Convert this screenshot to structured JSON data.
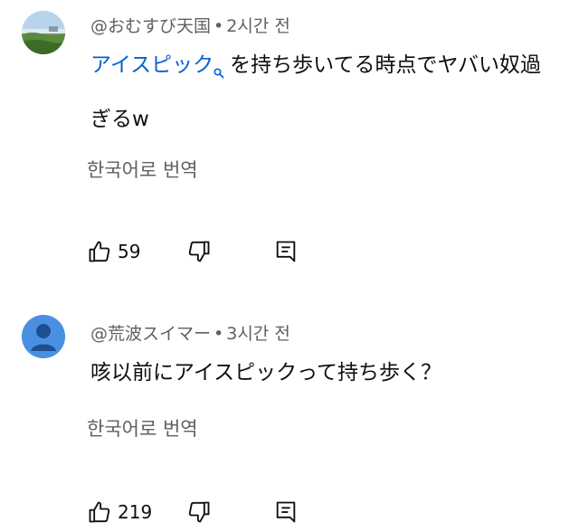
{
  "comments": [
    {
      "author": "@おむすび天国",
      "separator": "•",
      "time": "2시간 전",
      "link_text": "アイスピック",
      "text_after_link": "を持ち歩いてる時点でヤバい奴過ぎるw",
      "translate_label": "한국어로 번역",
      "likes": "59",
      "avatar_icon": "landscape-avatar"
    },
    {
      "author": "@荒波スイマー",
      "separator": "•",
      "time": "3시간 전",
      "text": "咳以前にアイスピックって持ち歩く？",
      "translate_label": "한국어로 번역",
      "likes": "219",
      "avatar_icon": "default-person-avatar"
    }
  ],
  "colors": {
    "link": "#065fd4",
    "meta": "#606060",
    "text": "#0f0f0f",
    "avatar_default": "#4a90e2"
  }
}
